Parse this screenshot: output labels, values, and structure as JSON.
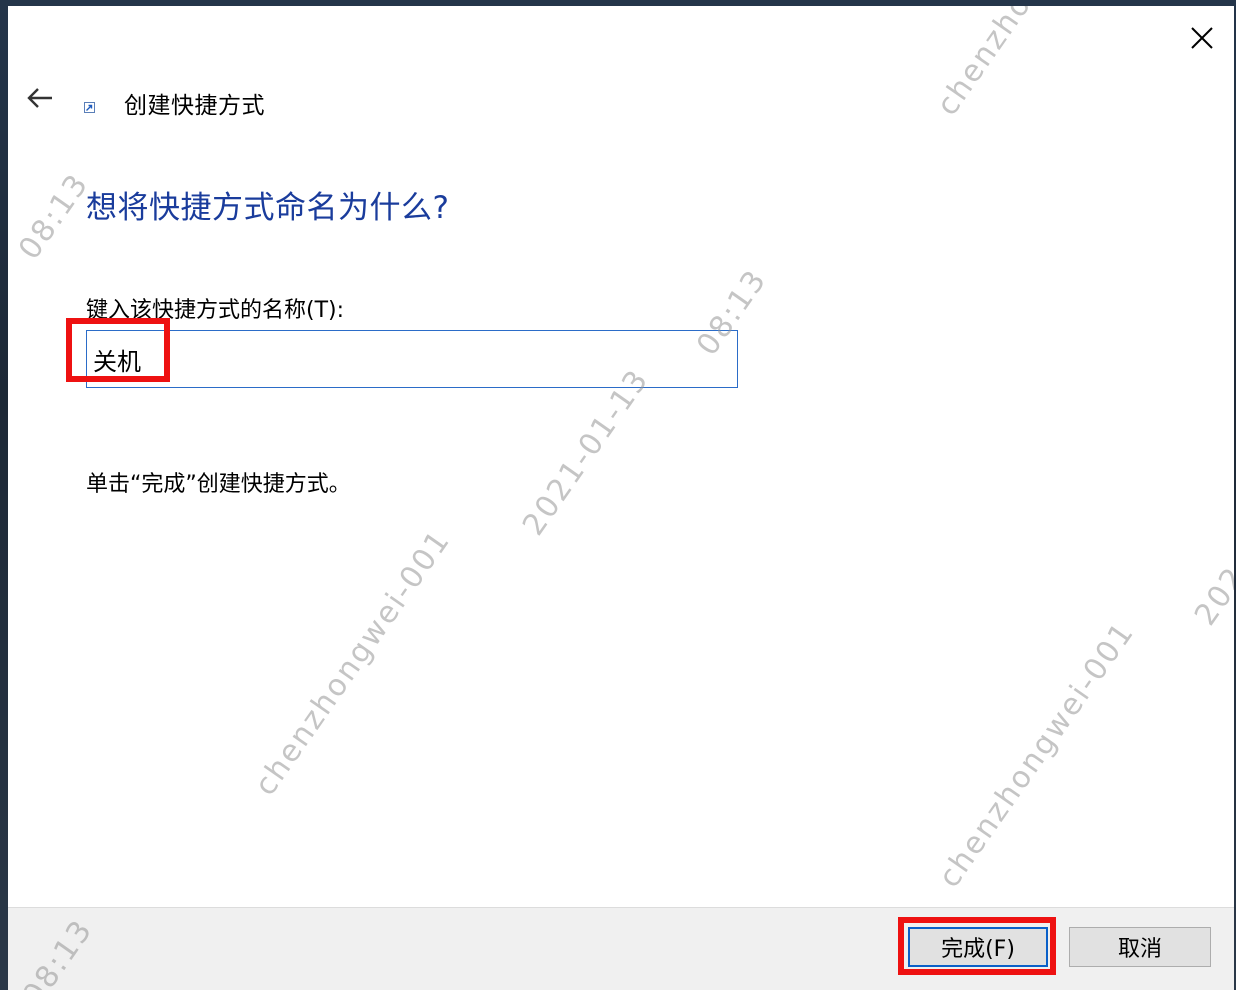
{
  "dialog": {
    "title": "创建快捷方式",
    "heading": "想将快捷方式命名为什么?",
    "field_label": "键入该快捷方式的名称(T):",
    "name_value": "关机",
    "instruction": "单击“完成”创建快捷方式。",
    "finish_label": "完成(F)",
    "cancel_label": "取消"
  },
  "watermark": {
    "user": "chenzhongwei-001",
    "date": "2021-01-13",
    "time": "08:13",
    "user_fragment": "chenzho",
    "date_fragment": "202"
  },
  "icons": {
    "back": "back-arrow-icon",
    "close": "close-icon",
    "shortcut": "shortcut-icon"
  },
  "colors": {
    "heading": "#1a3c9c",
    "input_border": "#2b6cc8",
    "highlight": "#ee1111",
    "footer": "#f0f0f0"
  }
}
